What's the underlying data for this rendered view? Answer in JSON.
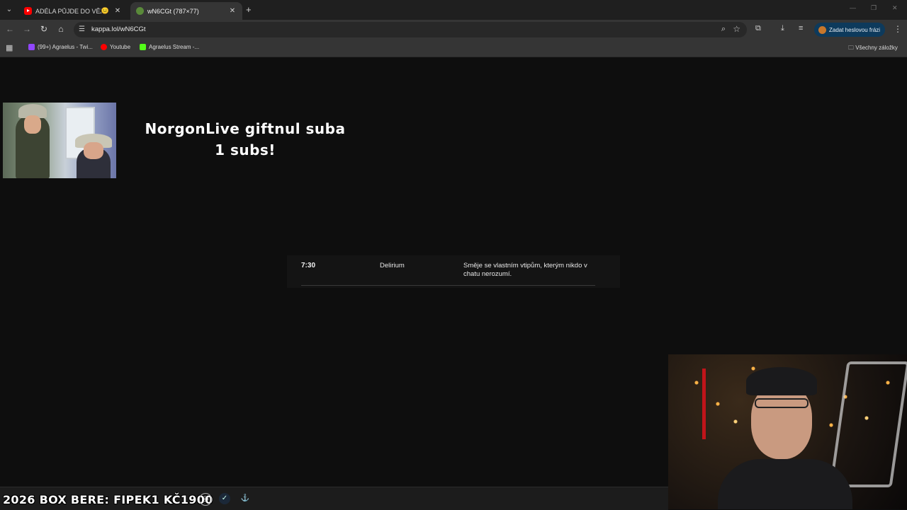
{
  "browser": {
    "tabs": [
      {
        "title": "ADÉLA PŮJDE DO VĚZENÍ?!",
        "emoji": "😐",
        "favicon": "youtube-icon"
      },
      {
        "title": "wN6CGt (787×77)",
        "favicon": "pepe-icon"
      }
    ],
    "url": "kappa.lol/wN6CGt",
    "profile_button": "Zadat heslovou frázi",
    "bookmarks": [
      {
        "label": "(99+) Agraelus - Twi...",
        "color": "#9146ff"
      },
      {
        "label": "Youtube",
        "color": "#ff0000"
      },
      {
        "label": "Agraelus Stream -...",
        "color": "#53fc18"
      }
    ],
    "all_bookmarks": "Všechny záložky"
  },
  "alert": {
    "line1": "NorgonLive giftnul suba",
    "line2": "1 subs!"
  },
  "tts": {
    "time": "7:30",
    "voice": "Delirium",
    "message": "Směje se vlastním vtipům, kterým nikdo v chatu nerozumí."
  },
  "taskbar": {
    "marquee": "2026 BOX BERE: FIPEK1 KČ1900"
  }
}
